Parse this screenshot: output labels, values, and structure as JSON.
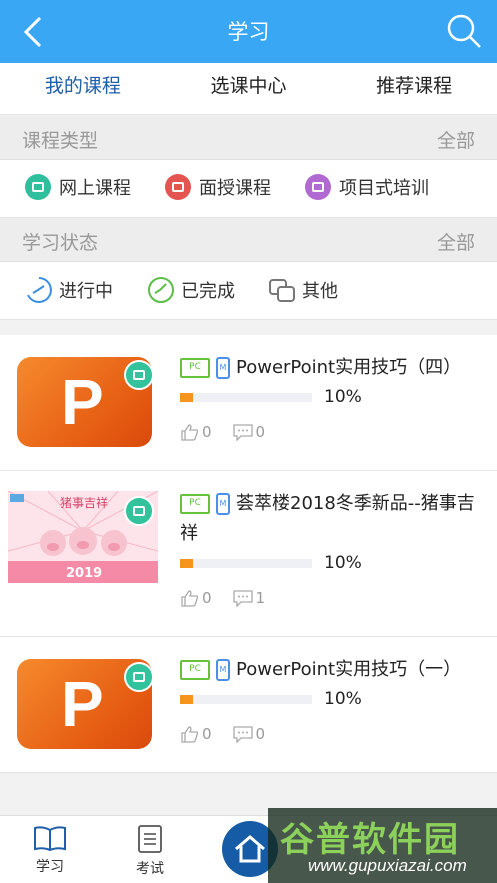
{
  "header": {
    "title": "学习"
  },
  "tabs": [
    {
      "label": "我的课程"
    },
    {
      "label": "选课中心"
    },
    {
      "label": "推荐课程"
    }
  ],
  "course_type": {
    "label": "课程类型",
    "all": "全部",
    "items": [
      {
        "label": "网上课程",
        "icon": "online-course-icon",
        "color": "#2fbf9c"
      },
      {
        "label": "面授课程",
        "icon": "classroom-course-icon",
        "color": "#e45450"
      },
      {
        "label": "项目式培训",
        "icon": "project-training-icon",
        "color": "#b06ad1"
      }
    ]
  },
  "study_status": {
    "label": "学习状态",
    "all": "全部",
    "items": [
      {
        "label": "进行中",
        "icon": "in-progress-icon",
        "color": "#3b8fe0"
      },
      {
        "label": "已完成",
        "icon": "completed-icon",
        "color": "#5bbd45"
      },
      {
        "label": "其他",
        "icon": "other-icon",
        "color": "#777777"
      }
    ]
  },
  "courses": [
    {
      "title": "PowerPoint实用技巧（四）",
      "device_pc": "PC",
      "device_mobile": "M",
      "progress": 0.1,
      "progress_label": "10%",
      "likes": "0",
      "comments": "0",
      "thumb": "ppt"
    },
    {
      "title": "荟萃楼2018冬季新品--猪事吉祥",
      "device_pc": "PC",
      "device_mobile": "M",
      "progress": 0.1,
      "progress_label": "10%",
      "likes": "0",
      "comments": "1",
      "thumb": "pig",
      "thumb_text": "猪事吉祥",
      "thumb_year": "2019"
    },
    {
      "title": "PowerPoint实用技巧（一）",
      "device_pc": "PC",
      "device_mobile": "M",
      "progress": 0.1,
      "progress_label": "10%",
      "likes": "0",
      "comments": "0",
      "thumb": "ppt"
    }
  ],
  "bottom_nav": {
    "study": "学习",
    "exam": "考试"
  },
  "watermark": {
    "title": "谷普软件园",
    "url": "www.gupuxiazai.com"
  },
  "colors": {
    "header": "#3aa7f4",
    "tab_active": "#1f5ea8",
    "progress_fill": "#f7941d",
    "home_button": "#155ba5"
  }
}
